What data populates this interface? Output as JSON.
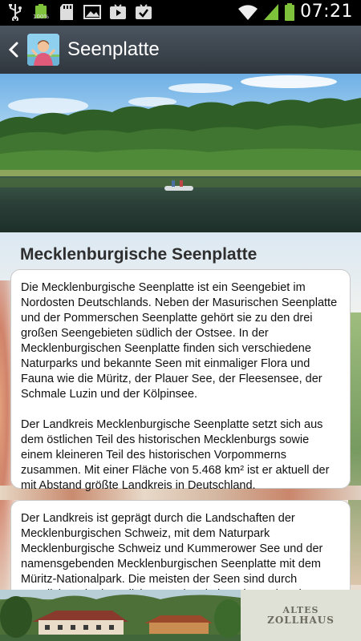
{
  "status_bar": {
    "time": "07:21",
    "icons": [
      "usb-icon",
      "battery-full-icon",
      "sd-card-icon",
      "image-icon",
      "play-store-icon",
      "checklist-icon",
      "wifi-icon",
      "signal-icon",
      "battery-icon"
    ],
    "battery_label": "100%"
  },
  "action_bar": {
    "title": "Seenplatte",
    "back_icon": "chevron-left-icon",
    "app_icon": "app-icon"
  },
  "article": {
    "heading": "Mecklenburgische Seenplatte",
    "card1_paragraphs": [
      "Die Mecklenburgische Seenplatte ist ein Seengebiet im Nordosten Deutschlands. Neben der Masurischen Seenplatte und der Pommerschen Seenplatte gehört sie zu den drei großen Seengebieten südlich der Ostsee. In der Mecklenburgischen Seenplatte finden sich verschiedene Naturparks und bekannte Seen mit einmaliger Flora und Fauna wie die Müritz, der Plauer See, der Fleesensee, der Schmale Luzin und der Kölpinsee.",
      "Der Landkreis Mecklenburgische Seenplatte setzt sich aus dem östlichen Teil des historischen Mecklenburgs sowie einem kleineren Teil des historischen Vorpommerns zusammen. Mit einer Fläche von 5.468 km² ist er aktuell der mit Abstand größte Landkreis in Deutschland."
    ],
    "card2_text": "Der Landkreis ist geprägt durch die Landschaften der Mecklenburgischen Schweiz, mit dem Naturpark Mecklenburgische Schweiz und Kummerower See und der namensgebenden Mecklenburgischen Seenplatte mit dem Müritz-Nationalpark. Die meisten der Seen sind durch natürliche oder künstliche Kanäle miteinander verbunden."
  },
  "banner": {
    "logo_line1": "ALTES",
    "logo_line2": "ZOLLHAUS"
  }
}
